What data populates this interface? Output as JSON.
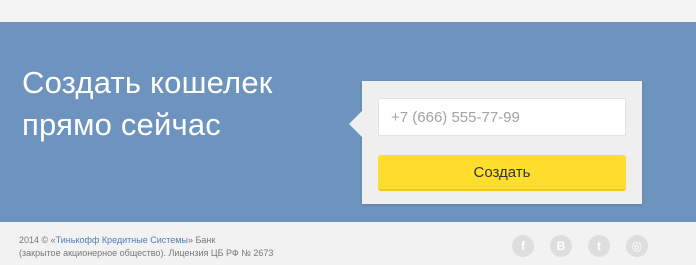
{
  "hero": {
    "headline_line1": "Создать кошелек",
    "headline_line2": "прямо сейчас"
  },
  "form": {
    "phone_placeholder": "+7 (666) 555-77-99",
    "create_label": "Создать"
  },
  "footer": {
    "year_prefix": "2014 © «",
    "company_link": "Тинькофф Кредитные Системы",
    "bank_suffix": "» Банк",
    "legal_line2": "(закрытое акционерное общество). Лицензия ЦБ РФ № 2673"
  },
  "socials": [
    {
      "icon": "facebook-icon",
      "glyph": "f"
    },
    {
      "icon": "vkontakte-icon",
      "glyph": "B"
    },
    {
      "icon": "twitter-icon",
      "glyph": "t"
    },
    {
      "icon": "instagram-icon",
      "glyph": "◎"
    }
  ],
  "colors": {
    "hero_bg": "#6d94bf",
    "button_bg": "#ffdd2d",
    "link": "#4f7fb4"
  }
}
